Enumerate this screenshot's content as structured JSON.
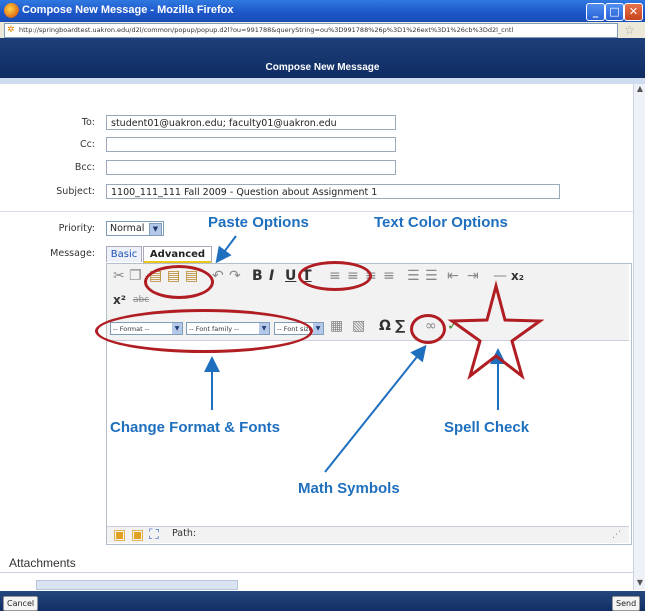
{
  "window": {
    "title": "Compose New Message - Mozilla Firefox",
    "minimize_glyph": "_",
    "maximize_glyph": "□",
    "close_glyph": "✕"
  },
  "browser": {
    "url": "http://springboardtest.uakron.edu/d2l/common/popup/popup.d2l?ou=991788&queryString=ou%3D991788%26p%3D1%26ext%3D1%26cb%3Dd2l_cntl"
  },
  "header": {
    "title": "Compose New Message"
  },
  "form": {
    "to_label": "To:",
    "to_value": "student01@uakron.edu; faculty01@uakron.edu",
    "cc_label": "Cc:",
    "cc_value": "",
    "bcc_label": "Bcc:",
    "bcc_value": "",
    "subject_label": "Subject:",
    "subject_value": "1100_111_111 Fall 2009 - Question about Assignment 1",
    "priority_label": "Priority:",
    "priority_value": "Normal",
    "message_label": "Message:"
  },
  "editor": {
    "tabs": [
      "Basic",
      "Advanced"
    ],
    "active_tab": "Advanced",
    "format_select": "-- Format --",
    "font_family_select": "-- Font family --",
    "font_size_select": "-- Font size --",
    "path_label": "Path:"
  },
  "attachments_label": "Attachments",
  "buttons": {
    "cancel": "Cancel",
    "send": "Send"
  },
  "annotations": {
    "paste_options": "Paste Options",
    "text_color_options": "Text Color Options",
    "change_format_fonts": "Change Format & Fonts",
    "spell_check": "Spell Check",
    "math_symbols": "Math Symbols"
  },
  "colors": {
    "annotation_text": "#1f6fbf",
    "annotation_circle": "#b01e23",
    "header_bg": "#142f66",
    "active_tab_underline": "#e8c81c"
  }
}
